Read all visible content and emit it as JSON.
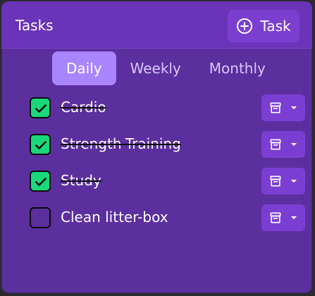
{
  "header": {
    "title": "Tasks",
    "add_button_label": "Task"
  },
  "tabs": [
    {
      "label": "Daily",
      "active": true
    },
    {
      "label": "Weekly",
      "active": false
    },
    {
      "label": "Monthly",
      "active": false
    }
  ],
  "tasks": [
    {
      "label": "Cardio",
      "done": true
    },
    {
      "label": "Strength-Training",
      "done": true
    },
    {
      "label": "Study",
      "done": true
    },
    {
      "label": "Clean litter-box",
      "done": false
    }
  ],
  "icons": {
    "add": "plus-circle-icon",
    "check": "checkmark-icon",
    "row_action": "archive-icon",
    "dropdown": "chevron-down-icon"
  },
  "colors": {
    "panel": "#5b2f9e",
    "header": "#6a34b8",
    "active_tab": "#a985ff",
    "checked": "#18d87a",
    "button": "#7a3fd2"
  }
}
